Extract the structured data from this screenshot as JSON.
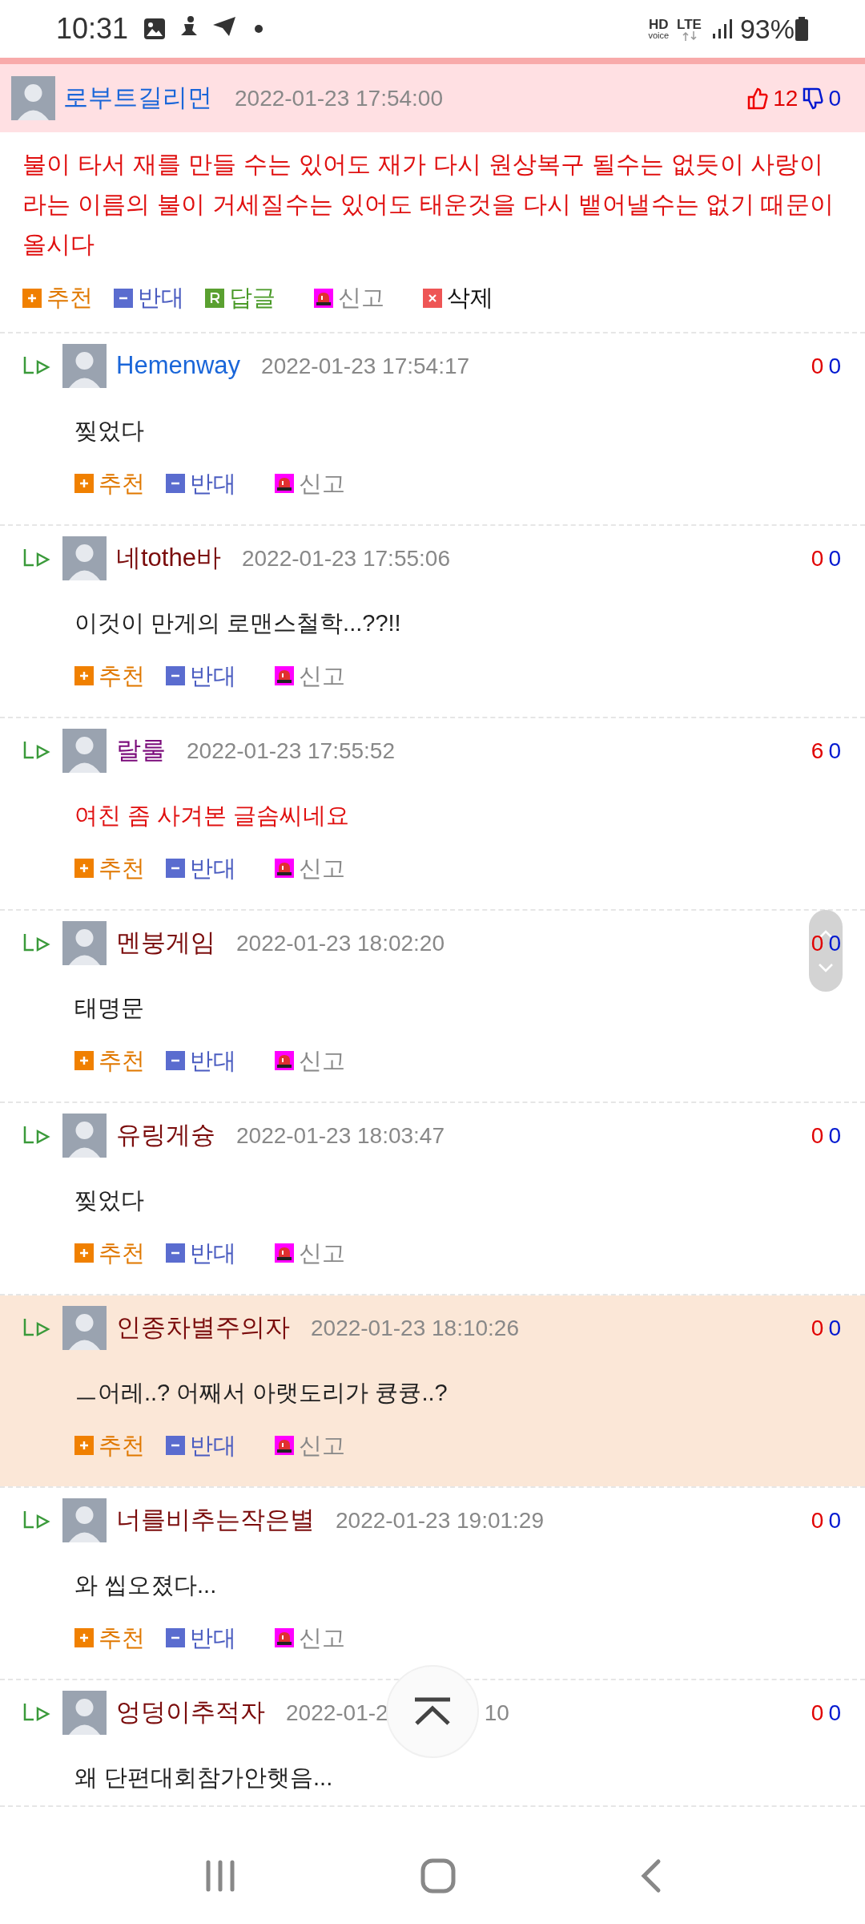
{
  "status_bar": {
    "time": "10:31",
    "hd": "HD",
    "voice": "voice",
    "network": "LTE",
    "battery": "93%"
  },
  "post": {
    "author": "로부트길리먼",
    "date": "2022-01-23 17:54:00",
    "up": "12",
    "down": "0",
    "body": "불이 타서 재를 만들 수는 있어도 재가 다시 원상복구 될수는 없듯이 사랑이라는 이름의 불이 거세질수는 있어도 태운것을 다시 뱉어낼수는 없기 때문이올시다",
    "actions": [
      {
        "kind": "recommend",
        "label": "추천"
      },
      {
        "kind": "oppose",
        "label": "반대"
      },
      {
        "kind": "reply",
        "label": "답글"
      },
      {
        "kind": "report",
        "label": "신고"
      },
      {
        "kind": "delete",
        "label": "삭제"
      }
    ]
  },
  "replies": [
    {
      "author": "Hemenway",
      "color": "#1a66d9",
      "date": "2022-01-23 17:54:17",
      "up": "0",
      "down": "0",
      "body": "찢었다",
      "body_red": false,
      "highlighted": false,
      "actions": [
        {
          "kind": "recommend",
          "label": "추천"
        },
        {
          "kind": "oppose",
          "label": "반대"
        },
        {
          "kind": "report",
          "label": "신고"
        }
      ]
    },
    {
      "author": "네tothe바",
      "color": "#7a0b0b",
      "date": "2022-01-23 17:55:06",
      "up": "0",
      "down": "0",
      "body": "이것이 만게의 로맨스철학...??!!",
      "body_red": false,
      "highlighted": false,
      "actions": [
        {
          "kind": "recommend",
          "label": "추천"
        },
        {
          "kind": "oppose",
          "label": "반대"
        },
        {
          "kind": "report",
          "label": "신고"
        }
      ]
    },
    {
      "author": "랄룰",
      "color": "#7a0a7a",
      "date": "2022-01-23 17:55:52",
      "up": "6",
      "down": "0",
      "body": "여친 좀 사겨본 글솜씨네요",
      "body_red": true,
      "highlighted": false,
      "actions": [
        {
          "kind": "recommend",
          "label": "추천"
        },
        {
          "kind": "oppose",
          "label": "반대"
        },
        {
          "kind": "report",
          "label": "신고"
        }
      ]
    },
    {
      "author": "멘붕게임",
      "color": "#7a0b0b",
      "date": "2022-01-23 18:02:20",
      "up": "0",
      "down": "0",
      "body": "태명문",
      "body_red": false,
      "highlighted": false,
      "actions": [
        {
          "kind": "recommend",
          "label": "추천"
        },
        {
          "kind": "oppose",
          "label": "반대"
        },
        {
          "kind": "report",
          "label": "신고"
        }
      ]
    },
    {
      "author": "유링게슝",
      "color": "#7a0b0b",
      "date": "2022-01-23 18:03:47",
      "up": "0",
      "down": "0",
      "body": "찢었다",
      "body_red": false,
      "highlighted": false,
      "actions": [
        {
          "kind": "recommend",
          "label": "추천"
        },
        {
          "kind": "oppose",
          "label": "반대"
        },
        {
          "kind": "report",
          "label": "신고"
        }
      ]
    },
    {
      "author": "인종차별주의자",
      "color": "#7a0b0b",
      "date": "2022-01-23 18:10:26",
      "up": "0",
      "down": "0",
      "body": "ㅡ어레..? 어째서 아랫도리가 큥큥..?",
      "body_red": false,
      "highlighted": true,
      "actions": [
        {
          "kind": "recommend",
          "label": "추천"
        },
        {
          "kind": "oppose",
          "label": "반대"
        },
        {
          "kind": "report",
          "label": "신고"
        }
      ]
    },
    {
      "author": "너를비추는작은별",
      "color": "#7a0b0b",
      "date": "2022-01-23 19:01:29",
      "up": "0",
      "down": "0",
      "body": "와 씹오졌다...",
      "body_red": false,
      "highlighted": false,
      "actions": [
        {
          "kind": "recommend",
          "label": "추천"
        },
        {
          "kind": "oppose",
          "label": "반대"
        },
        {
          "kind": "report",
          "label": "신고"
        }
      ]
    },
    {
      "author": "엉덩이추적자",
      "color": "#7a0b0b",
      "date_start": "2022-01-2",
      "date_end": "10",
      "up": "0",
      "down": "0",
      "body": "왜 단편대회참가안햇음...",
      "body_red": false,
      "highlighted": false
    }
  ]
}
